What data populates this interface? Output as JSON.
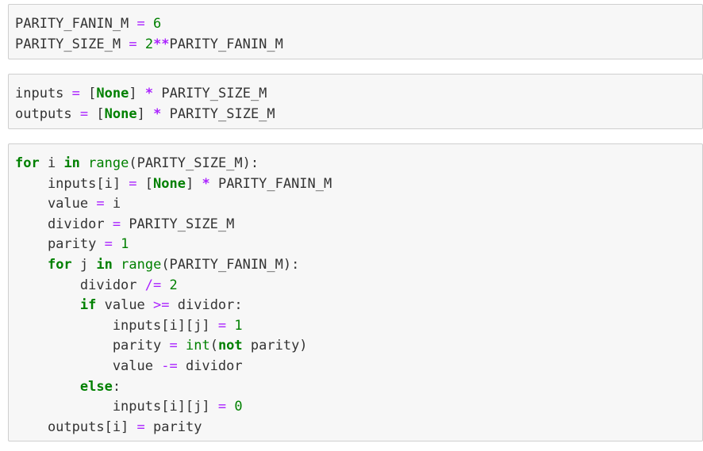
{
  "cells": [
    {
      "lines": [
        [
          {
            "t": "PARITY_FANIN_M",
            "c": "name"
          },
          {
            "t": " ",
            "c": "name"
          },
          {
            "t": "=",
            "c": "eq"
          },
          {
            "t": " ",
            "c": "name"
          },
          {
            "t": "6",
            "c": "num"
          }
        ],
        [
          {
            "t": "PARITY_SIZE_M",
            "c": "name"
          },
          {
            "t": " ",
            "c": "name"
          },
          {
            "t": "=",
            "c": "eq"
          },
          {
            "t": " ",
            "c": "name"
          },
          {
            "t": "2",
            "c": "num"
          },
          {
            "t": "**",
            "c": "op"
          },
          {
            "t": "PARITY_FANIN_M",
            "c": "name"
          }
        ]
      ]
    },
    {
      "lines": [
        [
          {
            "t": "inputs",
            "c": "name"
          },
          {
            "t": " ",
            "c": "name"
          },
          {
            "t": "=",
            "c": "eq"
          },
          {
            "t": " ",
            "c": "name"
          },
          {
            "t": "[",
            "c": "punct"
          },
          {
            "t": "None",
            "c": "kw"
          },
          {
            "t": "]",
            "c": "punct"
          },
          {
            "t": " ",
            "c": "name"
          },
          {
            "t": "*",
            "c": "op"
          },
          {
            "t": " PARITY_SIZE_M",
            "c": "name"
          }
        ],
        [
          {
            "t": "outputs",
            "c": "name"
          },
          {
            "t": " ",
            "c": "name"
          },
          {
            "t": "=",
            "c": "eq"
          },
          {
            "t": " ",
            "c": "name"
          },
          {
            "t": "[",
            "c": "punct"
          },
          {
            "t": "None",
            "c": "kw"
          },
          {
            "t": "]",
            "c": "punct"
          },
          {
            "t": " ",
            "c": "name"
          },
          {
            "t": "*",
            "c": "op"
          },
          {
            "t": " PARITY_SIZE_M",
            "c": "name"
          }
        ]
      ]
    },
    {
      "lines": [
        [
          {
            "t": "for",
            "c": "kw"
          },
          {
            "t": " i ",
            "c": "name"
          },
          {
            "t": "in",
            "c": "kw"
          },
          {
            "t": " ",
            "c": "name"
          },
          {
            "t": "range",
            "c": "bi"
          },
          {
            "t": "(PARITY_SIZE_M):",
            "c": "name"
          }
        ],
        [
          {
            "t": "    inputs[i] ",
            "c": "name"
          },
          {
            "t": "=",
            "c": "eq"
          },
          {
            "t": " [",
            "c": "name"
          },
          {
            "t": "None",
            "c": "kw"
          },
          {
            "t": "] ",
            "c": "name"
          },
          {
            "t": "*",
            "c": "op"
          },
          {
            "t": " PARITY_FANIN_M",
            "c": "name"
          }
        ],
        [
          {
            "t": "    value ",
            "c": "name"
          },
          {
            "t": "=",
            "c": "eq"
          },
          {
            "t": " i",
            "c": "name"
          }
        ],
        [
          {
            "t": "    dividor ",
            "c": "name"
          },
          {
            "t": "=",
            "c": "eq"
          },
          {
            "t": " PARITY_SIZE_M",
            "c": "name"
          }
        ],
        [
          {
            "t": "    parity ",
            "c": "name"
          },
          {
            "t": "=",
            "c": "eq"
          },
          {
            "t": " ",
            "c": "name"
          },
          {
            "t": "1",
            "c": "num"
          }
        ],
        [
          {
            "t": "    ",
            "c": "name"
          },
          {
            "t": "for",
            "c": "kw"
          },
          {
            "t": " j ",
            "c": "name"
          },
          {
            "t": "in",
            "c": "kw"
          },
          {
            "t": " ",
            "c": "name"
          },
          {
            "t": "range",
            "c": "bi"
          },
          {
            "t": "(PARITY_FANIN_M):",
            "c": "name"
          }
        ],
        [
          {
            "t": "        dividor ",
            "c": "name"
          },
          {
            "t": "/=",
            "c": "eq"
          },
          {
            "t": " ",
            "c": "name"
          },
          {
            "t": "2",
            "c": "num"
          }
        ],
        [
          {
            "t": "        ",
            "c": "name"
          },
          {
            "t": "if",
            "c": "kw"
          },
          {
            "t": " value ",
            "c": "name"
          },
          {
            "t": ">=",
            "c": "eq"
          },
          {
            "t": " dividor:",
            "c": "name"
          }
        ],
        [
          {
            "t": "            inputs[i][j] ",
            "c": "name"
          },
          {
            "t": "=",
            "c": "eq"
          },
          {
            "t": " ",
            "c": "name"
          },
          {
            "t": "1",
            "c": "num"
          }
        ],
        [
          {
            "t": "            parity ",
            "c": "name"
          },
          {
            "t": "=",
            "c": "eq"
          },
          {
            "t": " ",
            "c": "name"
          },
          {
            "t": "int",
            "c": "bi"
          },
          {
            "t": "(",
            "c": "name"
          },
          {
            "t": "not",
            "c": "kw"
          },
          {
            "t": " parity)",
            "c": "name"
          }
        ],
        [
          {
            "t": "            value ",
            "c": "name"
          },
          {
            "t": "-=",
            "c": "eq"
          },
          {
            "t": " dividor",
            "c": "name"
          }
        ],
        [
          {
            "t": "        ",
            "c": "name"
          },
          {
            "t": "else",
            "c": "kw"
          },
          {
            "t": ":",
            "c": "name"
          }
        ],
        [
          {
            "t": "            inputs[i][j] ",
            "c": "name"
          },
          {
            "t": "=",
            "c": "eq"
          },
          {
            "t": " ",
            "c": "name"
          },
          {
            "t": "0",
            "c": "num"
          }
        ],
        [
          {
            "t": "    outputs[i] ",
            "c": "name"
          },
          {
            "t": "=",
            "c": "eq"
          },
          {
            "t": " parity",
            "c": "name"
          }
        ]
      ]
    }
  ]
}
